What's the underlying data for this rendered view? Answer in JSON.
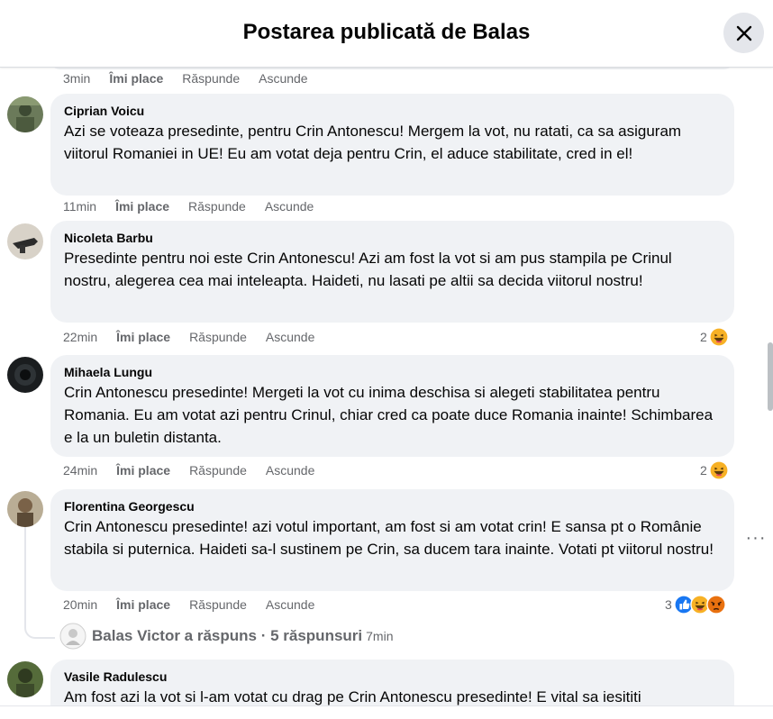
{
  "header": {
    "title": "Postarea publicată de Balas"
  },
  "actions": {
    "like": "Îmi place",
    "reply": "Răspunde",
    "hide": "Ascunde"
  },
  "previous_comment": {
    "time": "3min"
  },
  "comments": [
    {
      "author": "Ciprian Voicu",
      "text": "Azi se voteaza presedinte, pentru Crin Antonescu! Mergem la vot, nu ratati, ca sa asiguram viitorul Romaniei in UE! Eu am votat deja pentru Crin, el aduce stabilitate, cred in el!",
      "time": "11min"
    },
    {
      "author": "Nicoleta Barbu",
      "text": "Presedinte pentru noi este Crin Antonescu! Azi am fost la vot si am pus stampila pe Crinul nostru, alegerea cea mai inteleapta. Haideti, nu lasati pe altii sa decida viitorul nostru!",
      "time": "22min",
      "reaction_count": "2"
    },
    {
      "author": "Mihaela Lungu",
      "text": "Crin Antonescu presedinte! Mergeti la vot cu inima deschisa si alegeti stabilitatea pentru Romania. Eu am votat azi pentru Crinul, chiar cred ca poate duce Romania inainte! Schimbarea e la un buletin distanta.",
      "time": "24min",
      "reaction_count": "2"
    },
    {
      "author": "Florentina Georgescu",
      "text": "Crin Antonescu presedinte! azi votul important, am fost si am votat crin! E sansa pt o Românie stabila si puternica. Haideti sa-l sustinem pe Crin, sa ducem tara inainte. Votati pt viitorul nostru!",
      "time": "20min",
      "reaction_count": "3"
    },
    {
      "author": "Vasile Radulescu",
      "text": "Am fost azi la vot si l-am votat cu drag pe Crin Antonescu presedinte! E vital sa iesititi"
    }
  ],
  "replies": {
    "label": "Balas Victor a răspuns · 5 răspunsuri",
    "time": "7min"
  },
  "icons": {
    "close": "close-icon",
    "more": "more-options-icon",
    "haha": "haha-reaction-icon",
    "like": "like-reaction-icon",
    "angry": "angry-reaction-icon"
  },
  "colors": {
    "bubble": "#f0f2f5",
    "meta_text": "#65676b",
    "like_blue": "#1877f2",
    "haha_yellow": "#f7b125",
    "angry_orange": "#e9710f"
  }
}
